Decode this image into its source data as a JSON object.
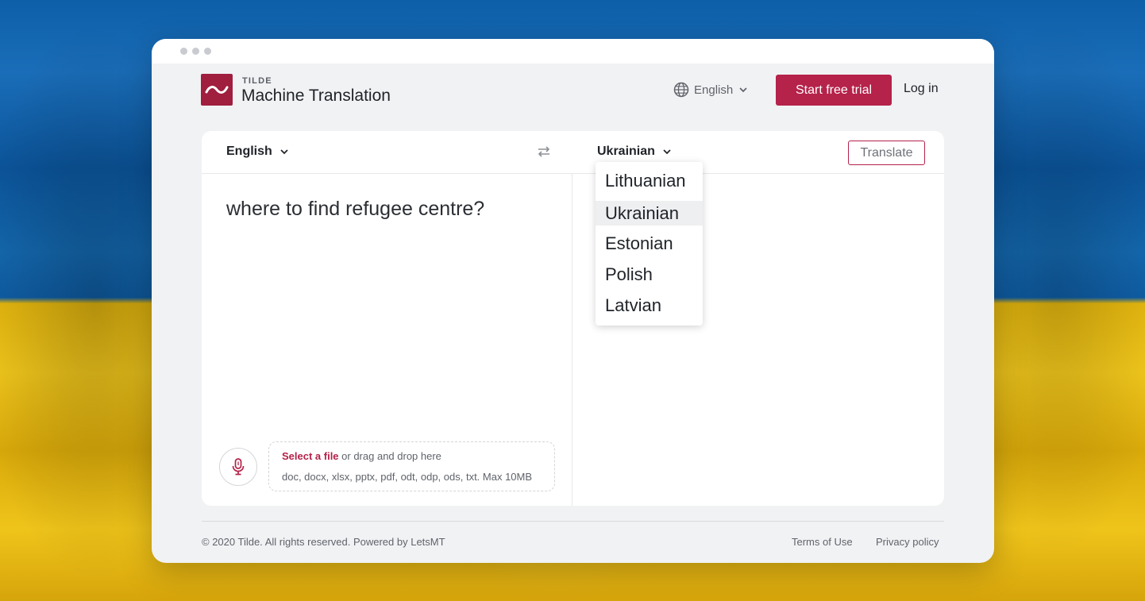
{
  "brand": {
    "small": "TILDE",
    "name": "Machine Translation",
    "logo_icon": "tilde-logo-icon",
    "logo_color": "#a01e3e"
  },
  "header": {
    "ui_language": "English",
    "ui_language_icon": "globe-icon",
    "trial_label": "Start free trial",
    "login_label": "Log in",
    "accent": "#b5224a"
  },
  "translator": {
    "source_language": "English",
    "target_language": "Ukrainian",
    "swap_icon": "swap-arrows-icon",
    "translate_label": "Translate",
    "source_text": "where to find refugee centre?",
    "target_dropdown": {
      "options": [
        "Lithuanian",
        "Ukrainian",
        "Estonian",
        "Polish",
        "Latvian"
      ],
      "selected": "Ukrainian"
    },
    "mic_icon": "microphone-icon",
    "upload": {
      "link": "Select a file",
      "rest": " or drag and drop here",
      "formats": "doc, docx, xlsx, pptx, pdf, odt, odp, ods, txt. Max 10MB"
    }
  },
  "footer": {
    "copyright": "© 2020 Tilde. All rights reserved. Powered by LetsMT",
    "terms": "Terms of Use",
    "privacy": "Privacy policy"
  }
}
